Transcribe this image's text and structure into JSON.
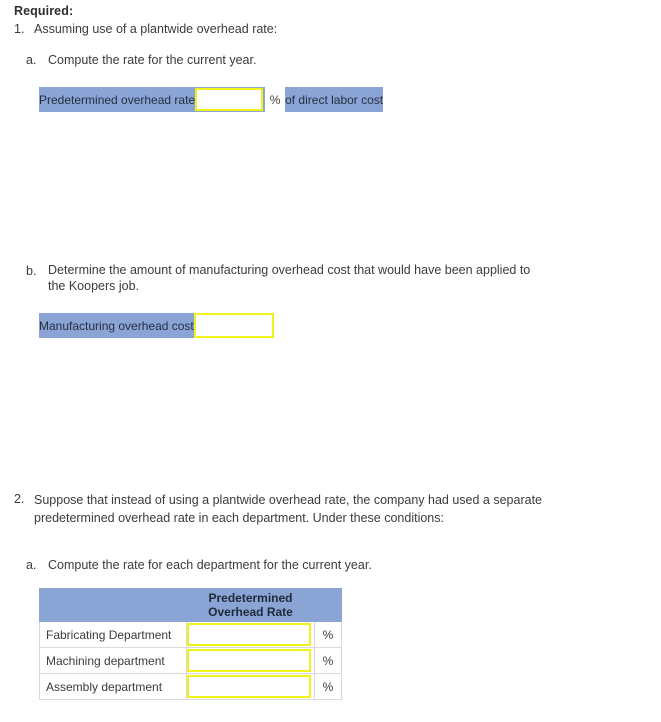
{
  "document": {
    "required_label": "Required:",
    "items": [
      {
        "marker": "1.",
        "text": "Assuming  use of a plantwide overhead rate:",
        "subitems": [
          {
            "marker": "a.",
            "text": "Compute the rate for the current year."
          },
          {
            "marker": "b.",
            "text": "Determine the amount of manufacturing overhead cost that would have been applied to the Koopers job."
          }
        ]
      },
      {
        "marker": "2.",
        "text_line1": "Suppose that instead of using a plantwide overhead rate, the company had used a separate",
        "text_line2": "predetermined overhead rate in each department. Under these conditions:",
        "subitems": [
          {
            "marker": "a.",
            "text": "Compute the rate for each department for the current year."
          }
        ]
      }
    ]
  },
  "rate_table": {
    "label": "Predetermined overhead rate",
    "input_value": "",
    "input_placeholder": "",
    "percent_symbol": "%",
    "suffix": "of direct labor cost"
  },
  "moh_table": {
    "label": "Manufacturing overhead cost",
    "input_value": "",
    "input_placeholder": ""
  },
  "dept_table": {
    "header": {
      "blank_label": "",
      "rate_line1": "Predetermined",
      "rate_line2": "Overhead Rate",
      "pct_blank": ""
    },
    "rows": [
      {
        "label": "Fabricating Department",
        "value": "",
        "percent_symbol": "%"
      },
      {
        "label": "Machining department",
        "value": "",
        "percent_symbol": "%"
      },
      {
        "label": "Assembly department",
        "value": "",
        "percent_symbol": "%"
      }
    ]
  },
  "colors": {
    "header_blue": "#8ba4d6",
    "field_border_yellow": "#f2f21a",
    "cell_border_gray": "#d9d9d9",
    "text": "#3b3b3b",
    "background": "#ffffff"
  }
}
